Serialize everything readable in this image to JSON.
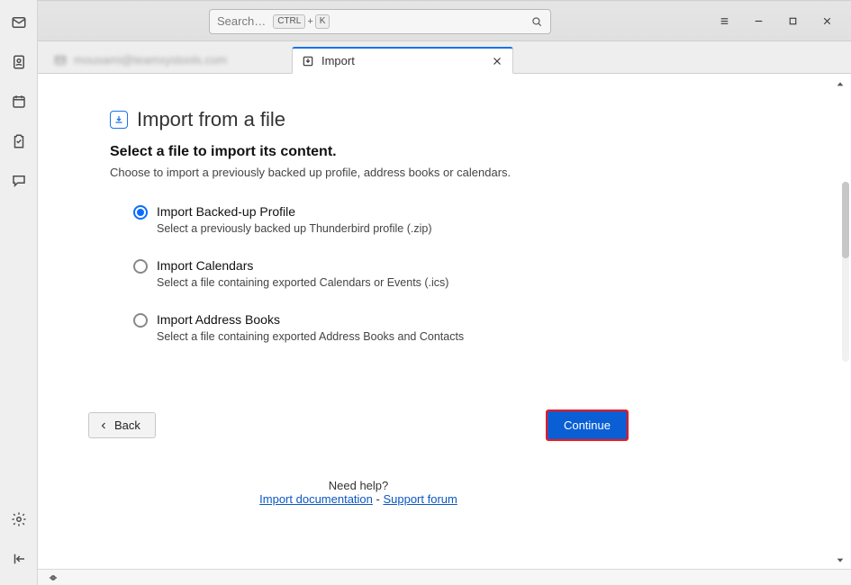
{
  "search": {
    "placeholder": "Search…",
    "kbd1": "CTRL",
    "kbd_plus": "+",
    "kbd2": "K"
  },
  "tabs": {
    "account_tab_label": "mousami@teamxystools.com",
    "import_tab_label": "Import"
  },
  "page": {
    "title": "Import from a file",
    "subtitle": "Select a file to import its content.",
    "description": "Choose to import a previously backed up profile, address books or calendars."
  },
  "options": [
    {
      "title": "Import Backed-up Profile",
      "desc": "Select a previously backed up Thunderbird profile (.zip)",
      "selected": true
    },
    {
      "title": "Import Calendars",
      "desc": "Select a file containing exported Calendars or Events (.ics)",
      "selected": false
    },
    {
      "title": "Import Address Books",
      "desc": "Select a file containing exported Address Books and Contacts",
      "selected": false
    }
  ],
  "buttons": {
    "back": "Back",
    "continue": "Continue"
  },
  "help": {
    "need": "Need help?",
    "link1": "Import documentation",
    "sep": " - ",
    "link2": "Support forum"
  }
}
